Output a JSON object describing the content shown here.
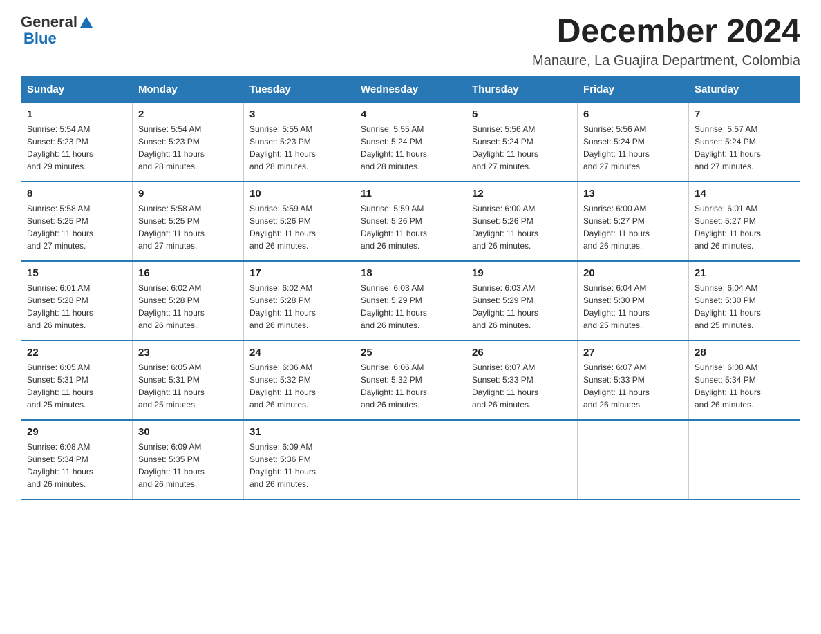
{
  "logo": {
    "text_general": "General",
    "text_blue": "Blue"
  },
  "title": "December 2024",
  "subtitle": "Manaure, La Guajira Department, Colombia",
  "days_of_week": [
    "Sunday",
    "Monday",
    "Tuesday",
    "Wednesday",
    "Thursday",
    "Friday",
    "Saturday"
  ],
  "weeks": [
    [
      {
        "day": "1",
        "sunrise": "5:54 AM",
        "sunset": "5:23 PM",
        "daylight": "11 hours and 29 minutes."
      },
      {
        "day": "2",
        "sunrise": "5:54 AM",
        "sunset": "5:23 PM",
        "daylight": "11 hours and 28 minutes."
      },
      {
        "day": "3",
        "sunrise": "5:55 AM",
        "sunset": "5:23 PM",
        "daylight": "11 hours and 28 minutes."
      },
      {
        "day": "4",
        "sunrise": "5:55 AM",
        "sunset": "5:24 PM",
        "daylight": "11 hours and 28 minutes."
      },
      {
        "day": "5",
        "sunrise": "5:56 AM",
        "sunset": "5:24 PM",
        "daylight": "11 hours and 27 minutes."
      },
      {
        "day": "6",
        "sunrise": "5:56 AM",
        "sunset": "5:24 PM",
        "daylight": "11 hours and 27 minutes."
      },
      {
        "day": "7",
        "sunrise": "5:57 AM",
        "sunset": "5:24 PM",
        "daylight": "11 hours and 27 minutes."
      }
    ],
    [
      {
        "day": "8",
        "sunrise": "5:58 AM",
        "sunset": "5:25 PM",
        "daylight": "11 hours and 27 minutes."
      },
      {
        "day": "9",
        "sunrise": "5:58 AM",
        "sunset": "5:25 PM",
        "daylight": "11 hours and 27 minutes."
      },
      {
        "day": "10",
        "sunrise": "5:59 AM",
        "sunset": "5:26 PM",
        "daylight": "11 hours and 26 minutes."
      },
      {
        "day": "11",
        "sunrise": "5:59 AM",
        "sunset": "5:26 PM",
        "daylight": "11 hours and 26 minutes."
      },
      {
        "day": "12",
        "sunrise": "6:00 AM",
        "sunset": "5:26 PM",
        "daylight": "11 hours and 26 minutes."
      },
      {
        "day": "13",
        "sunrise": "6:00 AM",
        "sunset": "5:27 PM",
        "daylight": "11 hours and 26 minutes."
      },
      {
        "day": "14",
        "sunrise": "6:01 AM",
        "sunset": "5:27 PM",
        "daylight": "11 hours and 26 minutes."
      }
    ],
    [
      {
        "day": "15",
        "sunrise": "6:01 AM",
        "sunset": "5:28 PM",
        "daylight": "11 hours and 26 minutes."
      },
      {
        "day": "16",
        "sunrise": "6:02 AM",
        "sunset": "5:28 PM",
        "daylight": "11 hours and 26 minutes."
      },
      {
        "day": "17",
        "sunrise": "6:02 AM",
        "sunset": "5:28 PM",
        "daylight": "11 hours and 26 minutes."
      },
      {
        "day": "18",
        "sunrise": "6:03 AM",
        "sunset": "5:29 PM",
        "daylight": "11 hours and 26 minutes."
      },
      {
        "day": "19",
        "sunrise": "6:03 AM",
        "sunset": "5:29 PM",
        "daylight": "11 hours and 26 minutes."
      },
      {
        "day": "20",
        "sunrise": "6:04 AM",
        "sunset": "5:30 PM",
        "daylight": "11 hours and 25 minutes."
      },
      {
        "day": "21",
        "sunrise": "6:04 AM",
        "sunset": "5:30 PM",
        "daylight": "11 hours and 25 minutes."
      }
    ],
    [
      {
        "day": "22",
        "sunrise": "6:05 AM",
        "sunset": "5:31 PM",
        "daylight": "11 hours and 25 minutes."
      },
      {
        "day": "23",
        "sunrise": "6:05 AM",
        "sunset": "5:31 PM",
        "daylight": "11 hours and 25 minutes."
      },
      {
        "day": "24",
        "sunrise": "6:06 AM",
        "sunset": "5:32 PM",
        "daylight": "11 hours and 26 minutes."
      },
      {
        "day": "25",
        "sunrise": "6:06 AM",
        "sunset": "5:32 PM",
        "daylight": "11 hours and 26 minutes."
      },
      {
        "day": "26",
        "sunrise": "6:07 AM",
        "sunset": "5:33 PM",
        "daylight": "11 hours and 26 minutes."
      },
      {
        "day": "27",
        "sunrise": "6:07 AM",
        "sunset": "5:33 PM",
        "daylight": "11 hours and 26 minutes."
      },
      {
        "day": "28",
        "sunrise": "6:08 AM",
        "sunset": "5:34 PM",
        "daylight": "11 hours and 26 minutes."
      }
    ],
    [
      {
        "day": "29",
        "sunrise": "6:08 AM",
        "sunset": "5:34 PM",
        "daylight": "11 hours and 26 minutes."
      },
      {
        "day": "30",
        "sunrise": "6:09 AM",
        "sunset": "5:35 PM",
        "daylight": "11 hours and 26 minutes."
      },
      {
        "day": "31",
        "sunrise": "6:09 AM",
        "sunset": "5:36 PM",
        "daylight": "11 hours and 26 minutes."
      },
      null,
      null,
      null,
      null
    ]
  ],
  "labels": {
    "sunrise": "Sunrise:",
    "sunset": "Sunset:",
    "daylight": "Daylight:"
  }
}
